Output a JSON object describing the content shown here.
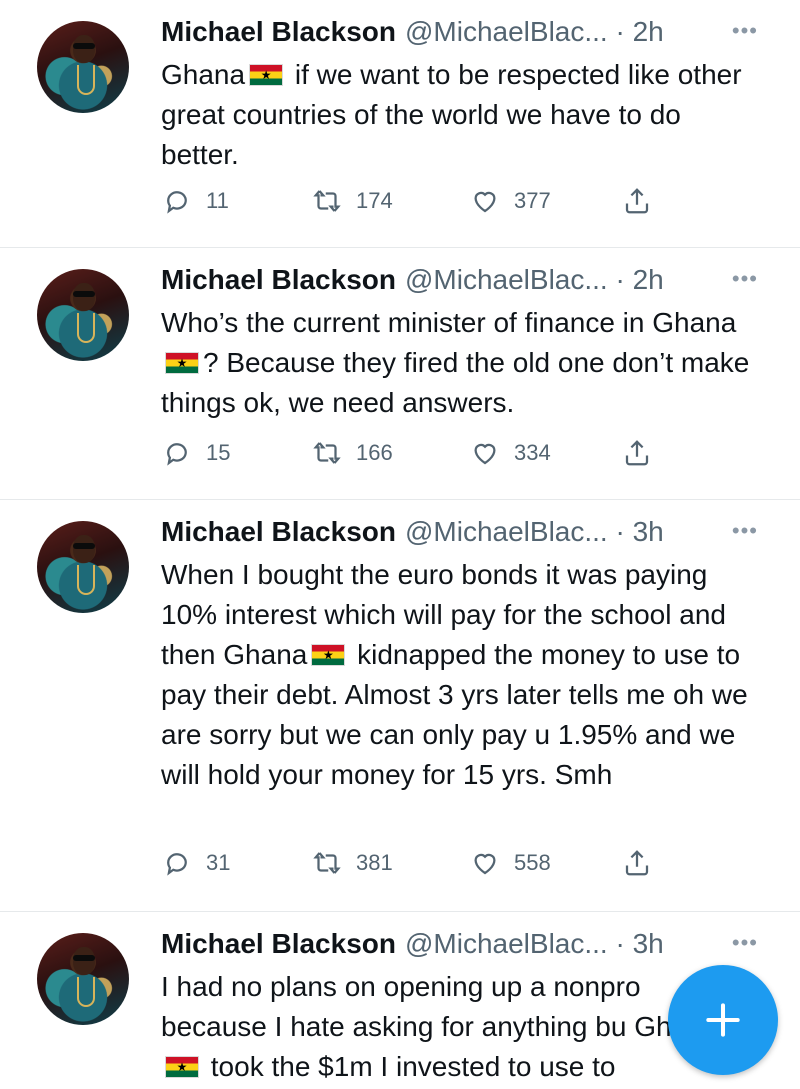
{
  "tweets": [
    {
      "name": "Michael Blackson",
      "handle": "@MichaelBlac... · 2h",
      "text_before_flag": "Ghana",
      "text_after_flag": " if we want to be respected like other great countries of the world we have to do better.",
      "replies": "11",
      "retweets": "174",
      "likes": "377"
    },
    {
      "name": "Michael Blackson",
      "handle": "@MichaelBlac... · 2h",
      "text_before_flag": "Who’s the current minister of finance in Ghana",
      "text_after_flag": "? Because they fired the old one don’t make things ok, we need answers.",
      "replies": "15",
      "retweets": "166",
      "likes": "334"
    },
    {
      "name": "Michael Blackson",
      "handle": "@MichaelBlac... · 3h",
      "text_before_flag": "When I bought the euro bonds it was paying 10% interest which will pay for the school and then Ghana",
      "text_after_flag": " kidnapped the money to use to pay their debt.  Almost 3 yrs later tells me oh we are sorry but we can only pay u 1.95% and we will hold your money for 15 yrs. Smh",
      "replies": "31",
      "retweets": "381",
      "likes": "558"
    },
    {
      "name": "Michael Blackson",
      "handle": "@MichaelBlac... · 3h",
      "text_before_flag": "I had no plans on opening up a nonpro because I hate asking for anything bu Ghana",
      "text_after_flag": " took the $1m I invested to use to",
      "replies": "",
      "retweets": "",
      "likes": ""
    }
  ],
  "icons": {
    "reply": "reply-icon",
    "retweet": "retweet-icon",
    "like": "heart-icon",
    "share": "share-icon",
    "more": "more-icon",
    "compose": "compose-plus-icon"
  },
  "colors": {
    "accent": "#1d9bf0",
    "secondary_text": "#536471",
    "divider": "#e6e9eb"
  }
}
